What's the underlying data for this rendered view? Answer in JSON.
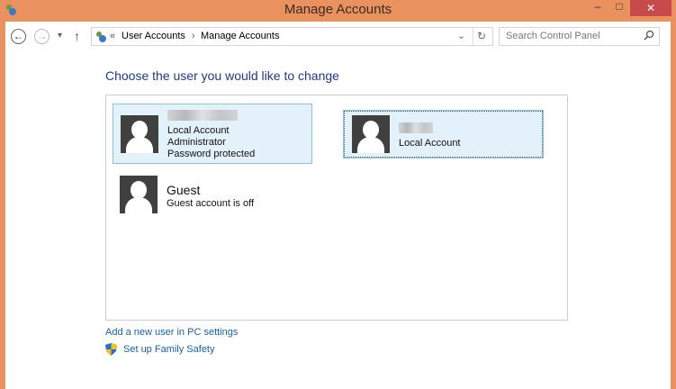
{
  "window": {
    "title": "Manage Accounts",
    "minimize": "–",
    "maximize": "□",
    "close": "✕"
  },
  "nav": {
    "back": "←",
    "forward": "→",
    "recent": "▾",
    "up": "↑",
    "refresh": "↻",
    "dropdown": "⌄"
  },
  "breadcrumb": {
    "overflow": "«",
    "items": [
      "User Accounts",
      "Manage Accounts"
    ],
    "sep": "›"
  },
  "search": {
    "placeholder": "Search Control Panel"
  },
  "heading": "Choose the user you would like to change",
  "accounts": [
    {
      "name": "",
      "lines": [
        "Local Account",
        "Administrator",
        "Password protected"
      ]
    },
    {
      "name": "",
      "lines": [
        "Local Account"
      ]
    },
    {
      "name": "Guest",
      "lines": [
        "Guest account is off"
      ]
    }
  ],
  "links": {
    "add_user": "Add a new user in PC settings",
    "family_safety": "Set up Family Safety"
  }
}
